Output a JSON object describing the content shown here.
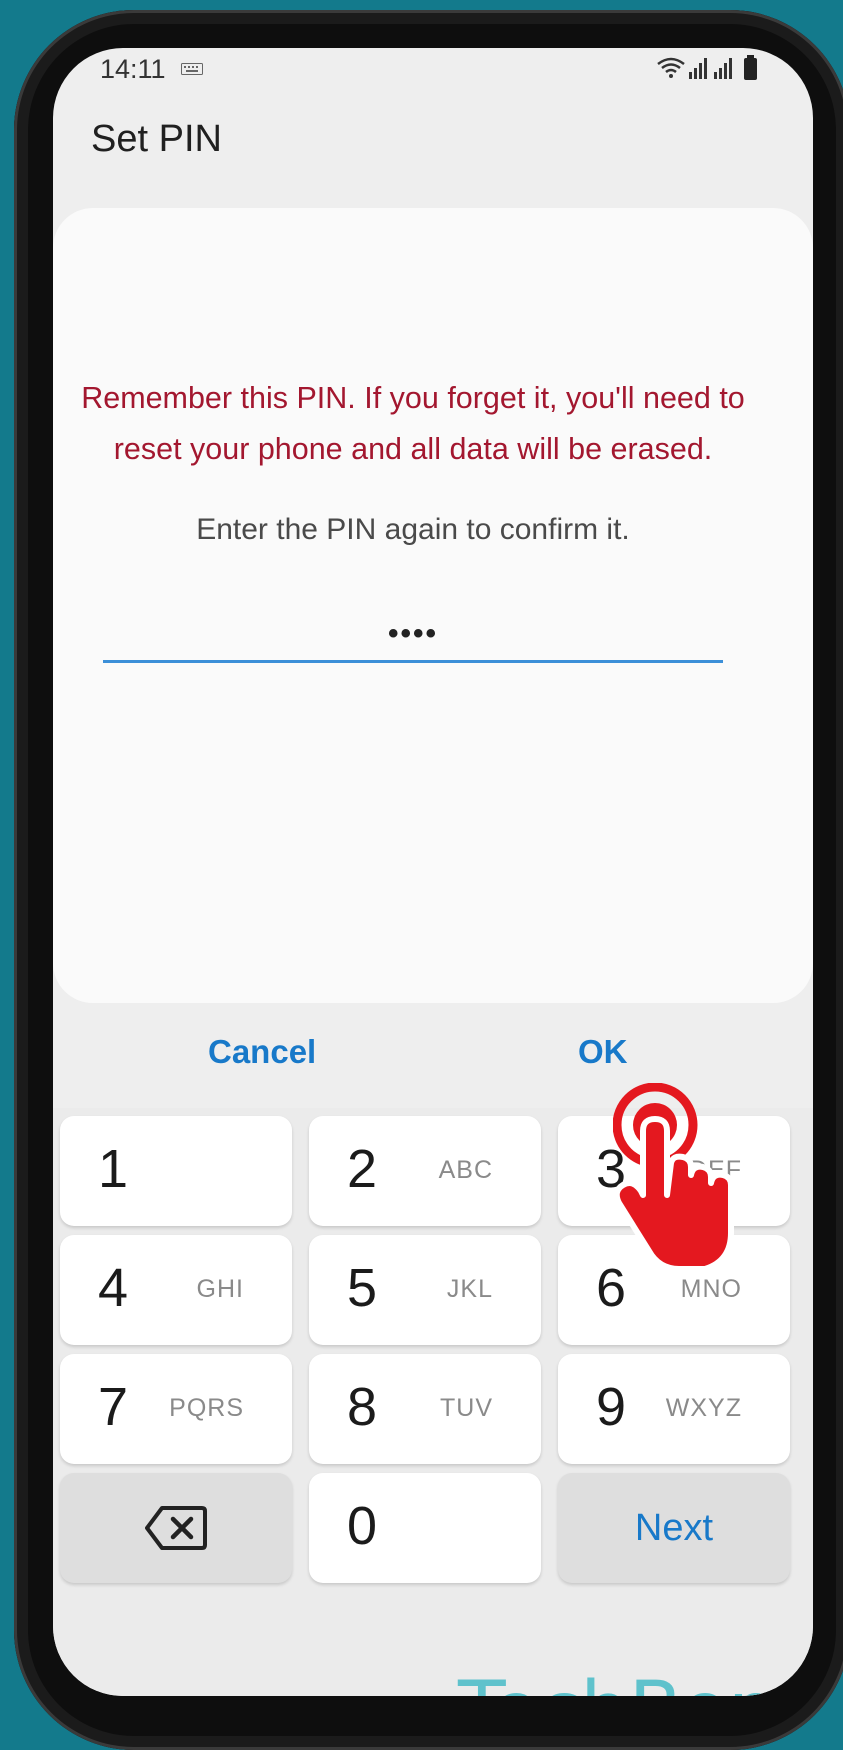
{
  "status_bar": {
    "time": "14:11",
    "icons": [
      "keyboard-icon",
      "wifi-icon",
      "signal-icon",
      "signal-icon",
      "battery-icon"
    ]
  },
  "app": {
    "title": "Set PIN"
  },
  "dialog": {
    "warning": "Remember this PIN. If you forget it, you'll need to reset your phone and all data will be erased.",
    "instruction": "Enter the PIN again to confirm it.",
    "pin_value": "••••",
    "cancel_label": "Cancel",
    "ok_label": "OK"
  },
  "keypad": {
    "keys": [
      {
        "digit": "1",
        "letters": ""
      },
      {
        "digit": "2",
        "letters": "ABC"
      },
      {
        "digit": "3",
        "letters": "DEF"
      },
      {
        "digit": "4",
        "letters": "GHI"
      },
      {
        "digit": "5",
        "letters": "JKL"
      },
      {
        "digit": "6",
        "letters": "MNO"
      },
      {
        "digit": "7",
        "letters": "PQRS"
      },
      {
        "digit": "8",
        "letters": "TUV"
      },
      {
        "digit": "9",
        "letters": "WXYZ"
      },
      {
        "digit": "0",
        "letters": ""
      }
    ],
    "next_label": "Next"
  },
  "watermark": "TechBone",
  "colors": {
    "background": "#137a8c",
    "warning": "#a3172f",
    "accent": "#1879c9",
    "tap_hand": "#e4181f"
  }
}
